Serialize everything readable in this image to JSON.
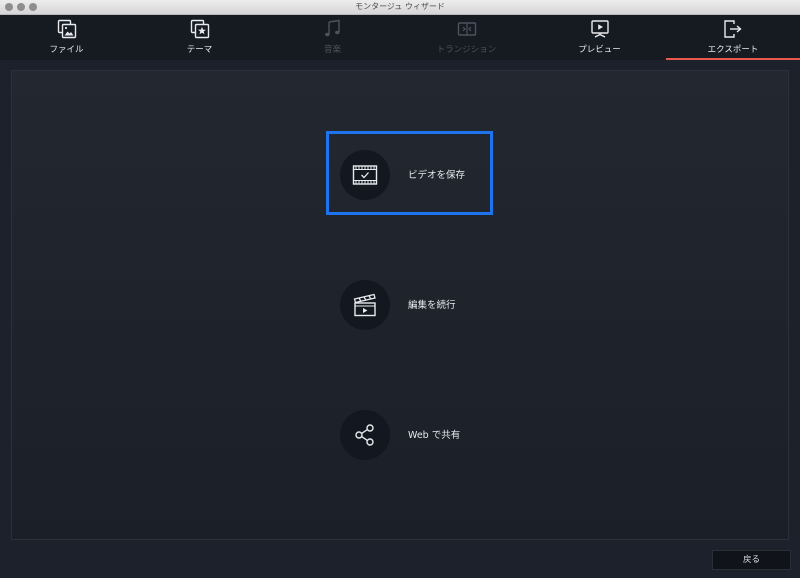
{
  "window": {
    "title": "モンタージュ ウィザード",
    "traffic_light_color": "#8e8e8e"
  },
  "tabs": [
    {
      "label": "ファイル",
      "icon": "file-images-icon",
      "state": "enabled"
    },
    {
      "label": "テーマ",
      "icon": "theme-star-icon",
      "state": "enabled"
    },
    {
      "label": "音楽",
      "icon": "music-note-icon",
      "state": "disabled"
    },
    {
      "label": "トランジション",
      "icon": "transition-icon",
      "state": "disabled"
    },
    {
      "label": "プレビュー",
      "icon": "preview-play-icon",
      "state": "enabled"
    },
    {
      "label": "エクスポート",
      "icon": "export-icon",
      "state": "active"
    }
  ],
  "options": [
    {
      "label": "ビデオを保存",
      "icon": "save-video-icon",
      "highlighted": true
    },
    {
      "label": "編集を続行",
      "icon": "clapperboard-icon",
      "highlighted": false
    },
    {
      "label": "Web で共有",
      "icon": "share-icon",
      "highlighted": false
    }
  ],
  "footer": {
    "back_label": "戻る"
  },
  "colors": {
    "accent_tab_underline": "#e8584c",
    "highlight_box": "#1e74ef",
    "background": "#1d212b",
    "tabbar": "#161a21"
  }
}
